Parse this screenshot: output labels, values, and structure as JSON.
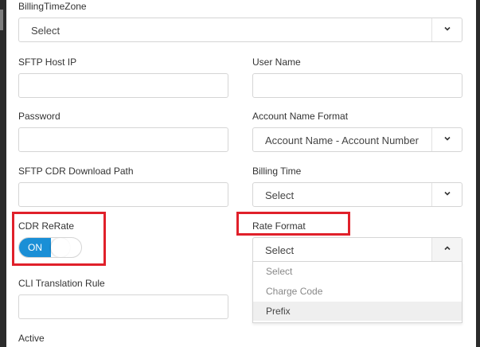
{
  "billing_timezone": {
    "label": "BillingTimeZone",
    "value": "Select"
  },
  "sftp_host_ip": {
    "label": "SFTP Host IP",
    "value": ""
  },
  "user_name": {
    "label": "User Name",
    "value": ""
  },
  "password": {
    "label": "Password",
    "value": ""
  },
  "account_name_format": {
    "label": "Account Name Format",
    "value": "Account Name - Account Number"
  },
  "sftp_cdr_download_path": {
    "label": "SFTP CDR Download Path",
    "value": ""
  },
  "billing_time": {
    "label": "Billing Time",
    "value": "Select"
  },
  "cdr_rerate": {
    "label": "CDR ReRate",
    "state": "ON"
  },
  "rate_format": {
    "label": "Rate Format",
    "value": "Select",
    "options": [
      "Select",
      "Charge Code",
      "Prefix"
    ],
    "highlighted": "Prefix"
  },
  "cli_translation_rule": {
    "label": "CLI Translation Rule",
    "value": ""
  },
  "active": {
    "label": "Active"
  },
  "colors": {
    "toggle_on": "#1a8fd6",
    "annotation": "#e0202a"
  },
  "icons": {
    "dropdown_caret": "chevron-down-icon",
    "open_caret": "chevron-up-icon"
  }
}
